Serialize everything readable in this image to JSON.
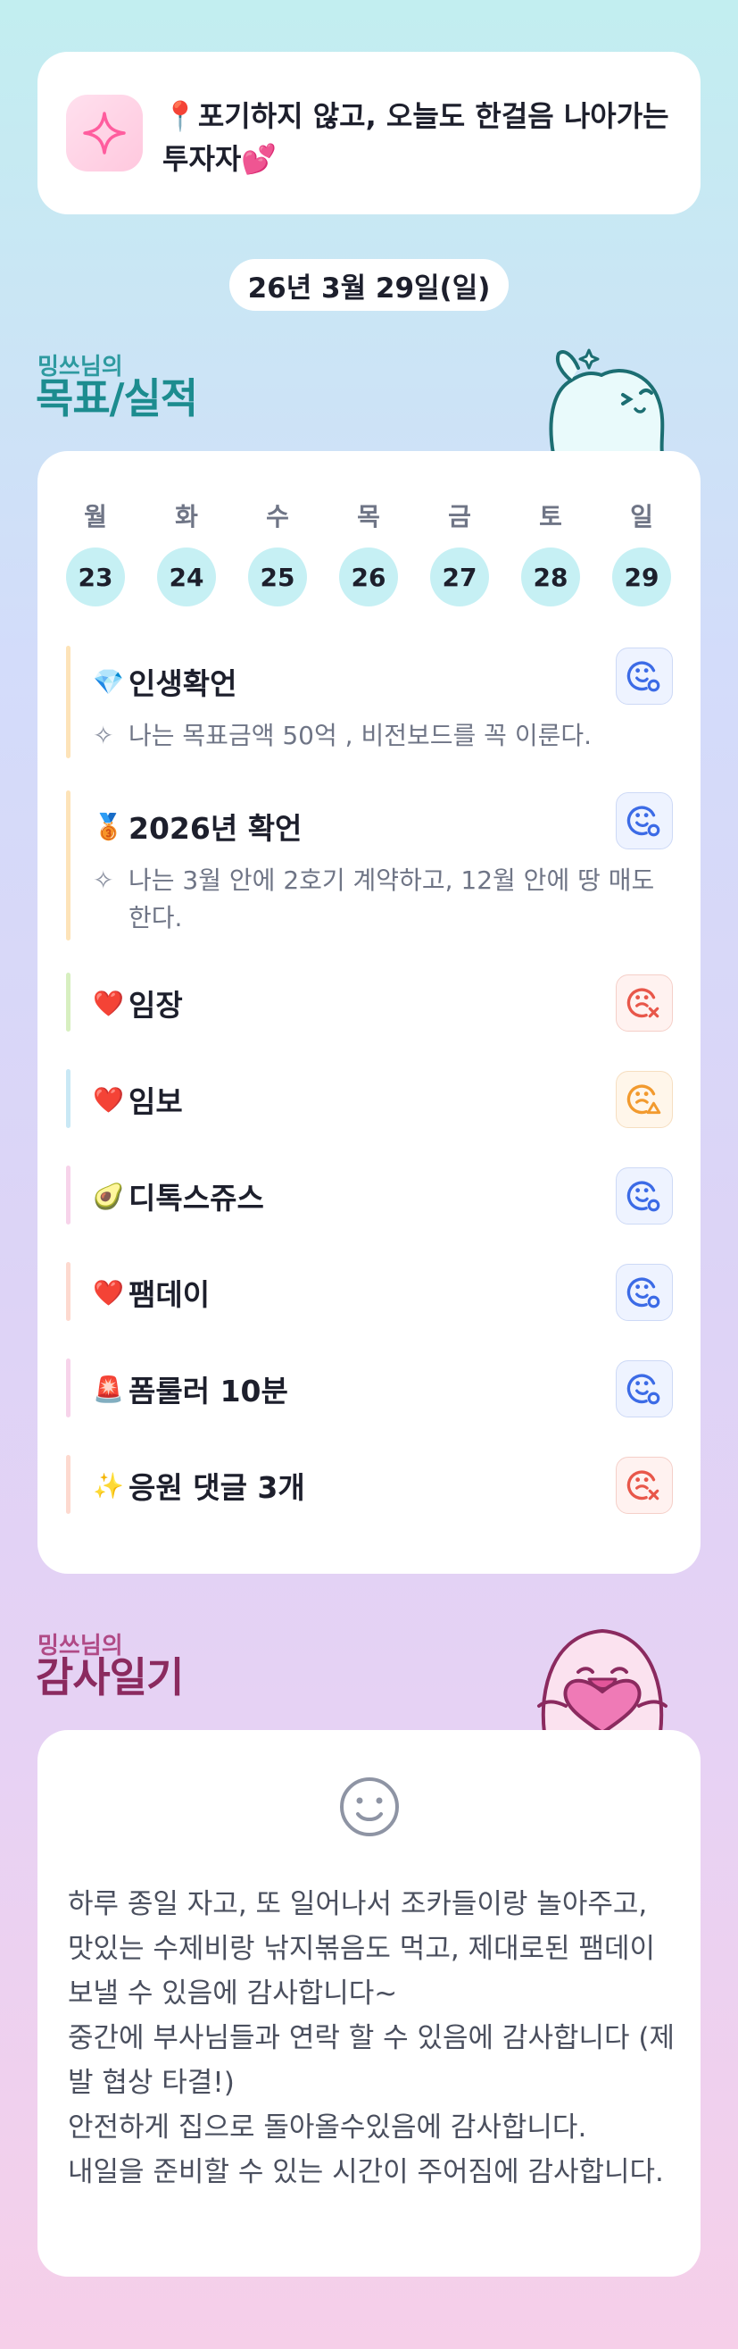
{
  "header": {
    "pin_emoji": "📍",
    "motto": "포기하지 않고, 오늘도 한걸음 나아가는 투자자",
    "heart_emoji": "💕",
    "sparkle_color": "#ff5d9e"
  },
  "date": "26년 3월 29일(일)",
  "goals_section": {
    "owner": "밍쓰님의",
    "title": "목표/실적",
    "week": {
      "days": [
        "월",
        "화",
        "수",
        "목",
        "금",
        "토",
        "일"
      ],
      "dates": [
        "23",
        "24",
        "25",
        "26",
        "27",
        "28",
        "29"
      ]
    },
    "items": [
      {
        "emoji": "💎",
        "label": "인생확언",
        "desc": "나는 목표금액 50억 , 비전보드를 꼭 이룬다.",
        "status": "done",
        "bar_color": "#fde3b8"
      },
      {
        "emoji": "🥉",
        "label": "2026년 확언",
        "desc": "나는 3월 안에 2호기 계약하고, 12월 안에 땅 매도한다.",
        "status": "done",
        "bar_color": "#fde3b8"
      },
      {
        "emoji": "❤️",
        "label": "임장",
        "desc": "",
        "status": "fail",
        "bar_color": "#d7efc0"
      },
      {
        "emoji": "❤️",
        "label": "임보",
        "desc": "",
        "status": "partial",
        "bar_color": "#c9e8f5"
      },
      {
        "emoji": "🥑",
        "label": "디톡스쥬스",
        "desc": "",
        "status": "done",
        "bar_color": "#f7d3ea"
      },
      {
        "emoji": "❤️",
        "label": "팸데이",
        "desc": "",
        "status": "done",
        "bar_color": "#fdd9cf"
      },
      {
        "emoji": "🚨",
        "label": "폼룰러 10분",
        "desc": "",
        "status": "done",
        "bar_color": "#f7d3ea"
      },
      {
        "emoji": "✨",
        "label": "응원 댓글 3개",
        "desc": "",
        "status": "fail",
        "bar_color": "#fdd9cf"
      }
    ],
    "status_colors": {
      "done": "#3c6be6",
      "fail": "#e8574a",
      "partial": "#f29a2e"
    }
  },
  "thanks_section": {
    "owner": "밍쓰님의",
    "title": "감사일기",
    "mood_icon": "neutral-smile-icon",
    "body": "하루 종일 자고, 또 일어나서 조카들이랑 놀아주고, 맛있는 수제비랑 낚지볶음도 먹고, 제대로된 팸데이 보낼 수 있음에 감사합니다~\n중간에 부사님들과 연락 할 수 있음에 감사합니다 (제발 협상 타결!)\n안전하게 집으로 돌아올수있음에 감사합니다.\n내일을 준비할 수 있는 시간이 주어짐에 감사합니다."
  }
}
